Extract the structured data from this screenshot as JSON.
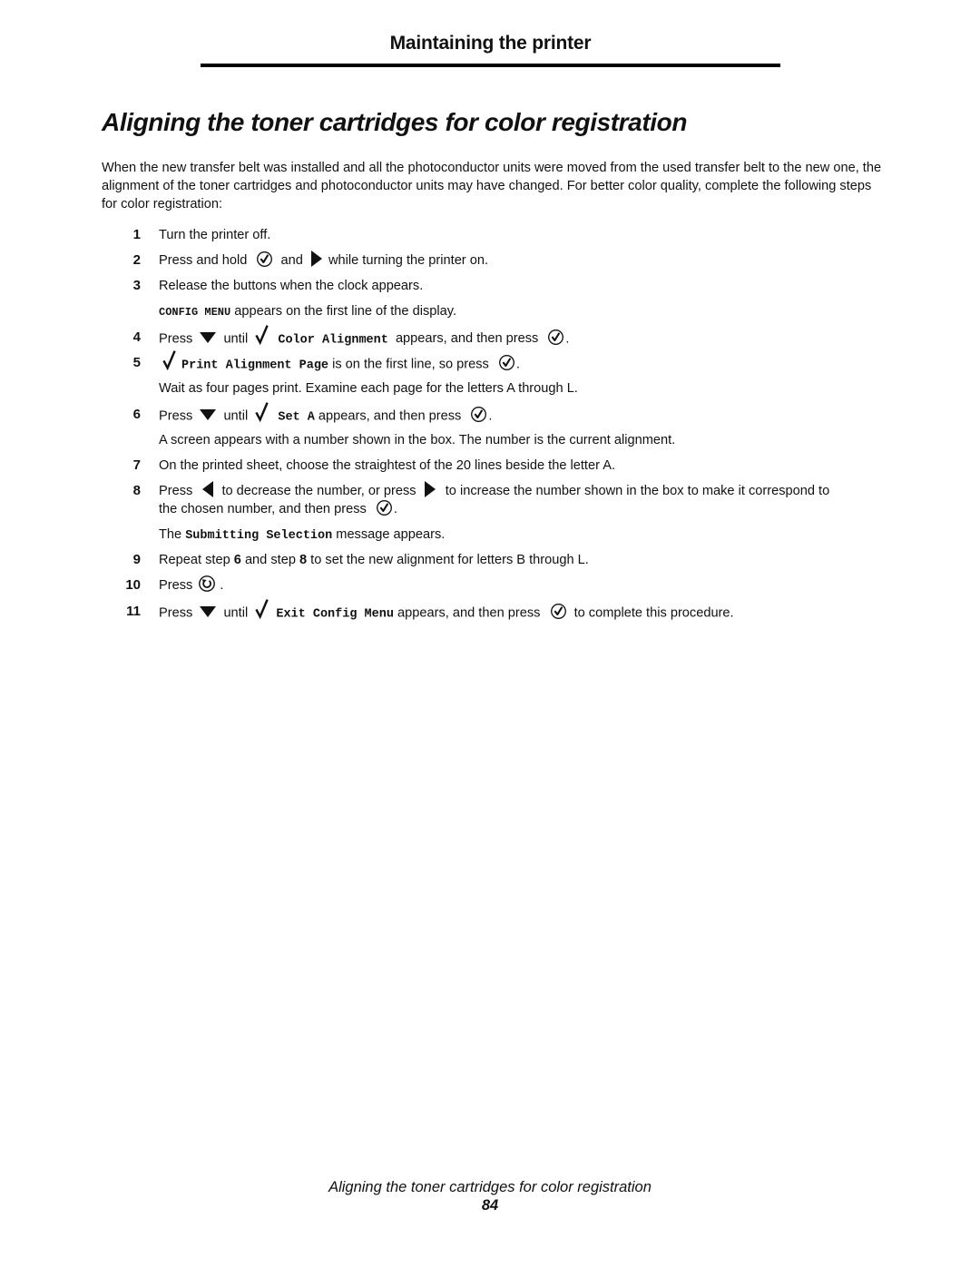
{
  "header": {
    "section_title": "Maintaining the printer"
  },
  "page_title": "Aligning the toner cartridges for color registration",
  "intro": "When the new transfer belt was installed and all the photoconductor units were moved from the used transfer belt to the new one, the alignment of the toner cartridges and photoconductor units may have changed. For better color quality, complete the following steps for color registration:",
  "icons": {
    "select": "select-button-icon (circled check)",
    "right": "right-arrow-icon",
    "left": "left-arrow-icon",
    "down": "down-arrow-icon",
    "check": "checkmark-icon",
    "return": "return-button-icon"
  },
  "steps": {
    "s1": {
      "num": "1",
      "text": "Turn the printer off."
    },
    "s2": {
      "num": "2",
      "t1": "Press and hold",
      "t2": "and",
      "t3": "while turning the printer on."
    },
    "s3": {
      "num": "3",
      "text": "Release the buttons when the clock appears."
    },
    "n3": {
      "code": "CONFIG MENU",
      "text": " appears on the first line of the display."
    },
    "s4": {
      "num": "4",
      "t1": "Press",
      "t2": "until",
      "code": "Color Alignment",
      "t3": "appears, and then press",
      "t4": "."
    },
    "s5": {
      "num": "5",
      "code": "Print Alignment Page",
      "t1": " is on the first line, so press",
      "t2": "."
    },
    "n5": {
      "text": "Wait as four pages print. Examine each page for the letters A through L."
    },
    "s6": {
      "num": "6",
      "t1": "Press",
      "t2": "until",
      "code": "Set A",
      "t3": "appears, and then press",
      "t4": "."
    },
    "n6": {
      "text": "A screen appears with a number shown in the box. The number is the current alignment."
    },
    "s7": {
      "num": "7",
      "text": "On the printed sheet, choose the straightest of the 20 lines beside the letter A."
    },
    "s8": {
      "num": "8",
      "t1": "Press",
      "t2": "to decrease the number, or press",
      "t3": "to increase the number shown in the box to make it correspond to",
      "t4": "the chosen number, and then press",
      "t5": "."
    },
    "n8": {
      "t1": "The ",
      "code": "Submitting Selection",
      "t2": " message appears."
    },
    "s9": {
      "num": "9",
      "t1": "Repeat step ",
      "ref1": "6",
      "t2": " and step ",
      "ref2": "8",
      "t3": " to set the new alignment for letters B through L."
    },
    "s10": {
      "num": "10",
      "t1": "Press",
      "t2": "."
    },
    "s11": {
      "num": "11",
      "t1": "Press",
      "t2": "until",
      "code": "Exit Config Menu",
      "t3": "appears, and then press",
      "t4": "to complete this procedure."
    }
  },
  "footer": {
    "title": "Aligning the toner cartridges for color registration",
    "page_number": "84"
  }
}
